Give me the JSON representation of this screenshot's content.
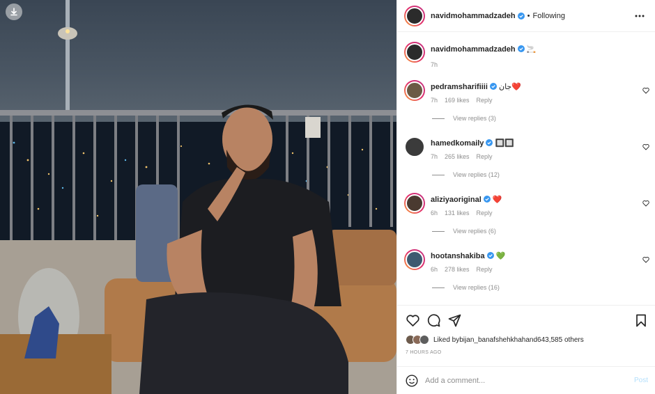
{
  "post": {
    "author": "navidmohammadzadeh",
    "following_label": "Following",
    "separator": "•"
  },
  "caption": {
    "username": "navidmohammadzadeh",
    "text": "🚬",
    "time": "7h"
  },
  "comments": [
    {
      "username": "pedramsharifiiii",
      "text": "جان❤️",
      "time": "7h",
      "likes": "169 likes",
      "reply": "Reply",
      "view_replies": "View replies (3)"
    },
    {
      "username": "hamedkomaily",
      "text": "🔲🔲",
      "time": "7h",
      "likes": "265 likes",
      "reply": "Reply",
      "view_replies": "View replies (12)"
    },
    {
      "username": "aliziyaoriginal",
      "text": "❤️",
      "time": "6h",
      "likes": "131 likes",
      "reply": "Reply",
      "view_replies": "View replies (6)"
    },
    {
      "username": "hootanshakiba",
      "text": "💚",
      "time": "6h",
      "likes": "278 likes",
      "reply": "Reply",
      "view_replies": "View replies (16)"
    }
  ],
  "likes": {
    "prefix": "Liked by ",
    "first_user": "bijan_banafshehkhah",
    "middle": " and ",
    "others": "643,585 others"
  },
  "time_ago": "7 HOURS AGO",
  "add_comment": {
    "placeholder": "Add a comment...",
    "post_label": "Post"
  },
  "colors": {
    "verified": "#3897f0",
    "link_disabled": "#b2dffc",
    "muted": "#8e8e8e"
  },
  "icons": [
    "download-icon",
    "more-icon",
    "verified-icon",
    "heart-icon",
    "comment-icon",
    "share-icon",
    "bookmark-icon",
    "emoji-icon"
  ]
}
